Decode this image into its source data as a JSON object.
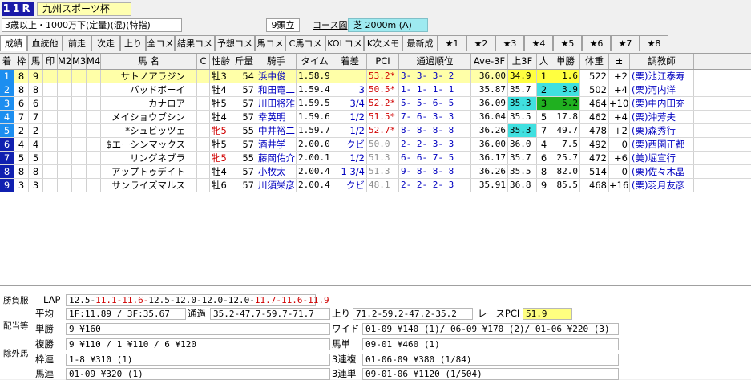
{
  "race": {
    "number": "11R",
    "name": "九州スポーツ杯",
    "conditions": "3歳以上・1000万下(定量)(混)(特指)",
    "runners": "9頭立",
    "course_label": "コース図",
    "course": "芝 2000m (A)"
  },
  "tabs": [
    "成績",
    "血統他",
    "前走",
    "次走",
    "上り",
    "全コメ",
    "結果コメ",
    "予想コメ",
    "馬コメ",
    "C馬コメ",
    "KOLコメ",
    "K次メモ",
    "最新成",
    "★1",
    "★2",
    "★3",
    "★4",
    "★5",
    "★6",
    "★7",
    "★8"
  ],
  "columns": [
    "着",
    "枠",
    "馬",
    "印",
    "M2",
    "M3",
    "M4",
    "馬 名",
    "C",
    "性齢",
    "斤量",
    "騎手",
    "タイム",
    "着差",
    "PCI",
    "通過順位",
    "Ave-3F",
    "上3F",
    "人",
    "単勝",
    "体重",
    "±",
    "調教師"
  ],
  "rows": [
    {
      "finish": "1",
      "waku": "8",
      "num": "9",
      "name": "サトノアラジン",
      "sexage": "牡3",
      "weight": "54",
      "jockey": "浜中俊",
      "time": "1.58.9",
      "margin": "",
      "pci": "53.2*",
      "passing": "3- 3- 3- 2",
      "ave3f": "36.00",
      "last3f": "34.9",
      "pop": "1",
      "odds": "1.6",
      "body": "522",
      "diff": "+2",
      "trainer": "(栗)池江泰寿"
    },
    {
      "finish": "2",
      "waku": "8",
      "num": "8",
      "name": "バッドボーイ",
      "sexage": "牡4",
      "weight": "57",
      "jockey": "和田竜二",
      "time": "1.59.4",
      "margin": "3",
      "pci": "50.5*",
      "passing": "1- 1- 1- 1",
      "ave3f": "35.87",
      "last3f": "35.7",
      "pop": "2",
      "odds": "3.9",
      "body": "502",
      "diff": "+4",
      "trainer": "(栗)河内洋"
    },
    {
      "finish": "3",
      "waku": "6",
      "num": "6",
      "name": "カナロア",
      "sexage": "牡5",
      "weight": "57",
      "jockey": "川田将雅",
      "time": "1.59.5",
      "margin": "3/4",
      "pci": "52.2*",
      "passing": "5- 5- 6- 5",
      "ave3f": "36.09",
      "last3f": "35.3",
      "pop": "3",
      "odds": "5.2",
      "body": "464",
      "diff": "+10",
      "trainer": "(栗)中内田充"
    },
    {
      "finish": "4",
      "waku": "7",
      "num": "7",
      "name": "メイショウブシン",
      "sexage": "牡4",
      "weight": "57",
      "jockey": "幸英明",
      "time": "1.59.6",
      "margin": "1/2",
      "pci": "51.5*",
      "passing": "7- 6- 3- 3",
      "ave3f": "36.04",
      "last3f": "35.5",
      "pop": "5",
      "odds": "17.8",
      "body": "462",
      "diff": "+4",
      "trainer": "(栗)沖芳夫"
    },
    {
      "finish": "5",
      "waku": "2",
      "num": "2",
      "name": "*シュビッツェ",
      "sexage": "牝5",
      "weight": "55",
      "jockey": "中井裕二",
      "time": "1.59.7",
      "margin": "1/2",
      "pci": "52.7*",
      "passing": "8- 8- 8- 8",
      "ave3f": "36.26",
      "last3f": "35.3",
      "pop": "7",
      "odds": "49.7",
      "body": "478",
      "diff": "+2",
      "trainer": "(栗)森秀行"
    },
    {
      "finish": "6",
      "waku": "4",
      "num": "4",
      "name": "$エーシンマックス",
      "sexage": "牡5",
      "weight": "57",
      "jockey": "酒井学",
      "time": "2.00.0",
      "margin": "クビ",
      "pci": "50.0",
      "passing": "2- 2- 3- 3",
      "ave3f": "36.00",
      "last3f": "36.0",
      "pop": "4",
      "odds": "7.5",
      "body": "492",
      "diff": "0",
      "trainer": "(栗)西園正都"
    },
    {
      "finish": "7",
      "waku": "5",
      "num": "5",
      "name": "リングネブラ",
      "sexage": "牝5",
      "weight": "55",
      "jockey": "藤岡佑介",
      "time": "2.00.1",
      "margin": "1/2",
      "pci": "51.3",
      "passing": "6- 6- 7- 5",
      "ave3f": "36.17",
      "last3f": "35.7",
      "pop": "6",
      "odds": "25.7",
      "body": "472",
      "diff": "+6",
      "trainer": "(美)堀宣行"
    },
    {
      "finish": "8",
      "waku": "8",
      "num": "8",
      "name": "アップトゥデイト",
      "sexage": "牡4",
      "weight": "57",
      "jockey": "小牧太",
      "time": "2.00.4",
      "margin": "1 3/4",
      "pci": "51.3",
      "passing": "9- 8- 8- 8",
      "ave3f": "36.26",
      "last3f": "35.5",
      "pop": "8",
      "odds": "82.0",
      "body": "514",
      "diff": "0",
      "trainer": "(栗)佐々木晶"
    },
    {
      "finish": "9",
      "waku": "3",
      "num": "3",
      "name": "サンライズマルス",
      "sexage": "牡6",
      "weight": "57",
      "jockey": "川須栄彦",
      "time": "2.00.4",
      "margin": "クビ",
      "pci": "48.1",
      "passing": "2- 2- 2- 3",
      "ave3f": "35.91",
      "last3f": "36.8",
      "pop": "9",
      "odds": "85.5",
      "body": "468",
      "diff": "+16",
      "trainer": "(栗)羽月友彦"
    }
  ],
  "colors": {
    "finish_bg": [
      "#1c8ef0",
      "#1c8ef0",
      "#1c8ef0",
      "#1c8ef0",
      "#1c8ef0",
      "#1020b0",
      "#1020b0",
      "#1020b0",
      "#1020b0"
    ],
    "row_yellow": "#ffffa8",
    "last3f_1": "#ffff40",
    "last3f_3": "#40e0e0",
    "pop_1": "#ffff40",
    "pop_2": "#40e0e0",
    "pop_3": "#20b020"
  },
  "side_tabs": [
    "勝負服",
    "配当等",
    "除外馬"
  ],
  "lap": {
    "label": "LAP",
    "values": "12.5-11.1-11.6-12.5-12.0-12.0-12.0-11.7-11.6-11.9"
  },
  "avg": {
    "label": "平均",
    "values": "1F:11.89 / 3F:35.67",
    "passing_label": "通過",
    "passing": "35.2-47.7-59.7-71.7",
    "agari_label": "上り",
    "agari": "71.2-59.2-47.2-35.2",
    "pci_label": "レースPCI",
    "pci": "51.9"
  },
  "payouts": {
    "tansho_label": "単勝",
    "tansho": "9 ¥160",
    "fukusho_label": "複勝",
    "fukusho": "9 ¥110 / 1 ¥110 / 6 ¥120",
    "wakuren_label": "枠連",
    "wakuren": "1-8 ¥310 (1)",
    "umaren_label": "馬連",
    "umaren": "01-09 ¥320 (1)",
    "wide_label": "ワイド",
    "wide": "01-09 ¥140 (1)/ 06-09 ¥170 (2)/ 01-06 ¥220 (3)",
    "umatan_label": "馬単",
    "umatan": "09-01 ¥460 (1)",
    "sanrenpuku_label": "3連複",
    "sanrenpuku": "01-06-09 ¥380 (1/84)",
    "sanrentan_label": "3連単",
    "sanrentan": "09-01-06 ¥1120 (1/504)"
  }
}
